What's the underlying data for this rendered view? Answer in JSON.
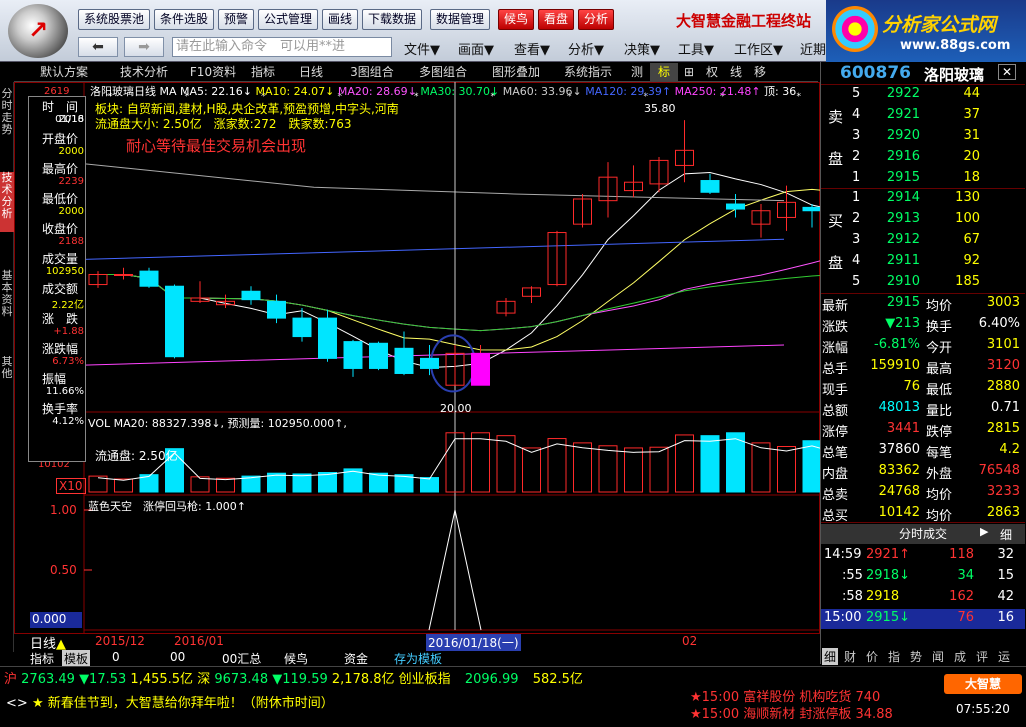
{
  "toolbar": {
    "buttons": [
      "系统股票池",
      "条件选股",
      "预警",
      "公式管理",
      "画线",
      "下载数据",
      "数据管理",
      "候鸟",
      "看盘",
      "分析"
    ],
    "brand": "大智慧金融工程终站",
    "command_placeholder": "请在此输入命令　可以用**进",
    "menus": [
      "文件▼",
      "画面▼",
      "查看▼",
      "分析▼",
      "决策▼",
      "工具▼",
      "工作区▼",
      "近期"
    ]
  },
  "banner": {
    "title": "分析家公式网",
    "url": "www.88gs.com"
  },
  "tabs": [
    "默认方案",
    "技术分析",
    "F10资料",
    "指标",
    "日线",
    "3图组合",
    "多图组合",
    "图形叠加",
    "系统指示",
    "测",
    "标",
    "⊞",
    "权",
    "线",
    "移"
  ],
  "side_tabs": [
    "分时走势",
    "技术分析",
    "基本资料",
    "其他"
  ],
  "chart_header": {
    "name": "洛阳玻璃",
    "period": "日线",
    "ma_label": "MA",
    "ma5": "MA5: 22.16↓",
    "ma10": "MA10: 24.07↓",
    "ma20": "MA20: 28.69↓",
    "ma30": "MA30: 30.70↓",
    "ma60": "MA60: 33.96↓",
    "ma120": "MA120: 29.39↑",
    "ma250": "MA250: 21.48↑",
    "top_label": "顶: 36",
    "sector": "板块: 自贸新闻,建材,H股,央企改革,预盈预增,中字头,河南",
    "float_info": "流通盘大小: 2.50亿　涨家数:272　跌家数:763",
    "note": "耐心等待最佳交易机会出现",
    "high_mark": "35.80",
    "low_mark": "20.00",
    "y_top": "2619"
  },
  "info_panel": {
    "rows": [
      {
        "label": "时　间",
        "value": "2016"
      },
      {
        "label": "",
        "value": "01/18"
      },
      {
        "label": "开盘价",
        "value": "2000"
      },
      {
        "label": "最高价",
        "value": "2239"
      },
      {
        "label": "最低价",
        "value": "2000"
      },
      {
        "label": "收盘价",
        "value": "2188"
      },
      {
        "label": "成交量",
        "value": "102950"
      },
      {
        "label": "成交额",
        "value": "2.22亿"
      },
      {
        "label": "涨　跌",
        "value": "+1.88"
      },
      {
        "label": "涨跌幅",
        "value": "6.73%"
      },
      {
        "label": "振幅",
        "value": "11.66%"
      },
      {
        "label": "换手率",
        "value": "4.12%"
      }
    ]
  },
  "vol_header": {
    "text": "VOL MA20: 88327.398↓, 预测量: 102950.000↑,",
    "sub": "流通盘: 2.50亿",
    "y1": "10102",
    "unit": "X10"
  },
  "indicator_header": {
    "text": "蓝色天空　涨停回马枪: 1.000↑",
    "ticks": [
      "1.00",
      "0.50",
      "0.000"
    ]
  },
  "x_axis": {
    "labels": [
      "2015/12",
      "2016/01",
      "2016/01/18(一)",
      "02"
    ]
  },
  "bottom_tabs": [
    "指标",
    "模板",
    "0",
    "00",
    "00汇总",
    "候鸟",
    "资金",
    "存为模板"
  ],
  "period_label": "日线",
  "quote": {
    "code": "600876",
    "name": "洛阳玻璃",
    "sell_label": [
      "卖",
      "盘"
    ],
    "buy_label": [
      "买",
      "盘"
    ],
    "sells": [
      {
        "lvl": "5",
        "price": "2922",
        "vol": "44"
      },
      {
        "lvl": "4",
        "price": "2921",
        "vol": "37"
      },
      {
        "lvl": "3",
        "price": "2920",
        "vol": "31"
      },
      {
        "lvl": "2",
        "price": "2916",
        "vol": "20"
      },
      {
        "lvl": "1",
        "price": "2915",
        "vol": "18"
      }
    ],
    "buys": [
      {
        "lvl": "1",
        "price": "2914",
        "vol": "130"
      },
      {
        "lvl": "2",
        "price": "2913",
        "vol": "100"
      },
      {
        "lvl": "3",
        "price": "2912",
        "vol": "67"
      },
      {
        "lvl": "4",
        "price": "2911",
        "vol": "92"
      },
      {
        "lvl": "5",
        "price": "2910",
        "vol": "185"
      }
    ],
    "stats": [
      {
        "l1": "最新",
        "v1": "2915",
        "l2": "均价",
        "v2": "3003"
      },
      {
        "l1": "涨跌",
        "v1": "▼213",
        "l2": "换手",
        "v2": "6.40%"
      },
      {
        "l1": "涨幅",
        "v1": "-6.81%",
        "l2": "今开",
        "v2": "3101"
      },
      {
        "l1": "总手",
        "v1": "159910",
        "l2": "最高",
        "v2": "3120"
      },
      {
        "l1": "现手",
        "v1": "76",
        "l2": "最低",
        "v2": "2880"
      },
      {
        "l1": "总额",
        "v1": "48013",
        "l2": "量比",
        "v2": "0.71"
      },
      {
        "l1": "涨停",
        "v1": "3441",
        "l2": "跌停",
        "v2": "2815"
      },
      {
        "l1": "总笔",
        "v1": "37860",
        "l2": "每笔",
        "v2": "4.2"
      },
      {
        "l1": "内盘",
        "v1": "83362",
        "l2": "外盘",
        "v2": "76548"
      },
      {
        "l1": "总卖",
        "v1": "24768",
        "l2": "均价",
        "v2": "3233"
      },
      {
        "l1": "总买",
        "v1": "10142",
        "l2": "均价",
        "v2": "2863"
      }
    ],
    "ticks_title": "分时成交",
    "ticks_btn": "细",
    "ticks": [
      {
        "t": "14:59",
        "p": "2921↑",
        "v": "118",
        "n": "32"
      },
      {
        "t": ":55",
        "p": "2918↓",
        "v": "34",
        "n": "15"
      },
      {
        "t": ":58",
        "p": "2918",
        "v": "162",
        "n": "42"
      },
      {
        "t": "15:00",
        "p": "2915↓",
        "v": "76",
        "n": "16"
      }
    ],
    "bottom_tabs": [
      "细",
      "财",
      "价",
      "指",
      "势",
      "闻",
      "成",
      "评",
      "运"
    ]
  },
  "status": {
    "sh_label": "沪",
    "sh_val": "2763.49",
    "sh_chg": "▼17.53",
    "sh_amt": "1,455.5亿",
    "sz_label": "深",
    "sz_val": "9673.48",
    "sz_chg": "▼119.59",
    "sz_amt": "2,178.8亿",
    "cy_label": "创业板指",
    "cy_val": "2096.99",
    "cy_amt": "582.5亿",
    "marquee": "新春佳节到，大智慧给你拜年啦！（附休市时间）",
    "news1": "★15:00 富祥股份 机构吃货 740",
    "news2": "★15:00 海顺新材 封涨停板 34.88",
    "logo": "大智慧",
    "time": "07:55:20"
  },
  "chart_data": {
    "type": "candlestick",
    "title": "洛阳玻璃 日线",
    "candles": [
      {
        "o": 26.0,
        "h": 26.8,
        "l": 25.8,
        "c": 26.6
      },
      {
        "o": 26.6,
        "h": 27.0,
        "l": 26.3,
        "c": 26.6
      },
      {
        "o": 26.8,
        "h": 27.0,
        "l": 25.8,
        "c": 25.9
      },
      {
        "o": 25.9,
        "h": 26.0,
        "l": 21.6,
        "c": 21.7
      },
      {
        "o": 25.0,
        "h": 26.2,
        "l": 24.9,
        "c": 25.2
      },
      {
        "o": 24.8,
        "h": 25.4,
        "l": 24.6,
        "c": 25.0
      },
      {
        "o": 25.6,
        "h": 25.9,
        "l": 24.8,
        "c": 25.1
      },
      {
        "o": 25.0,
        "h": 25.4,
        "l": 23.7,
        "c": 24.0
      },
      {
        "o": 24.0,
        "h": 24.6,
        "l": 22.6,
        "c": 22.9
      },
      {
        "o": 24.0,
        "h": 24.5,
        "l": 21.4,
        "c": 21.6
      },
      {
        "o": 22.6,
        "h": 22.7,
        "l": 20.5,
        "c": 21.0
      },
      {
        "o": 22.5,
        "h": 22.6,
        "l": 20.9,
        "c": 21.0
      },
      {
        "o": 22.2,
        "h": 23.2,
        "l": 20.6,
        "c": 20.7
      },
      {
        "o": 21.6,
        "h": 22.4,
        "l": 20.6,
        "c": 21.0
      },
      {
        "o": 20.0,
        "h": 22.4,
        "l": 20.0,
        "c": 21.9
      },
      {
        "o": 20.0,
        "h": 22.4,
        "l": 20.0,
        "c": 21.9
      },
      {
        "o": 24.3,
        "h": 25.2,
        "l": 24.1,
        "c": 25.0
      },
      {
        "o": 25.3,
        "h": 25.9,
        "l": 24.9,
        "c": 25.8
      },
      {
        "o": 26.0,
        "h": 29.2,
        "l": 25.9,
        "c": 29.1
      },
      {
        "o": 29.6,
        "h": 31.4,
        "l": 29.4,
        "c": 31.1
      },
      {
        "o": 31.0,
        "h": 33.3,
        "l": 30.0,
        "c": 32.4
      },
      {
        "o": 31.6,
        "h": 33.1,
        "l": 31.2,
        "c": 32.1
      },
      {
        "o": 32.0,
        "h": 33.6,
        "l": 31.5,
        "c": 33.4
      },
      {
        "o": 33.1,
        "h": 35.8,
        "l": 32.1,
        "c": 34.0
      },
      {
        "o": 32.2,
        "h": 32.6,
        "l": 31.4,
        "c": 31.5
      },
      {
        "o": 30.8,
        "h": 31.4,
        "l": 30.0,
        "c": 30.5
      },
      {
        "o": 29.6,
        "h": 30.8,
        "l": 28.8,
        "c": 30.4
      },
      {
        "o": 30.0,
        "h": 31.9,
        "l": 29.2,
        "c": 30.9
      },
      {
        "o": 30.6,
        "h": 30.8,
        "l": 29.4,
        "c": 30.4
      },
      {
        "o": 30.2,
        "h": 30.7,
        "l": 29.6,
        "c": 29.8
      },
      {
        "o": 29.5,
        "h": 30.1,
        "l": 28.2,
        "c": 28.4
      }
    ],
    "volumes": [
      22000,
      18000,
      24000,
      60000,
      21000,
      19000,
      22000,
      26000,
      25000,
      27000,
      32000,
      26000,
      24000,
      20000,
      82000,
      82000,
      78000,
      61000,
      74000,
      68000,
      64000,
      61000,
      62000,
      79000,
      78000,
      82000,
      68000,
      63000,
      71000,
      60000,
      55000
    ],
    "up_color": "#ff2a2a",
    "down_color": "#00e5ff",
    "ma_colors": {
      "ma5": "#ffffff",
      "ma10": "#ffff66",
      "ma20": "#ff55ff",
      "ma30": "#33cc33",
      "ma60": "#8888ff",
      "ma120": "#4466ff",
      "ma250": "#ff44ff"
    }
  }
}
